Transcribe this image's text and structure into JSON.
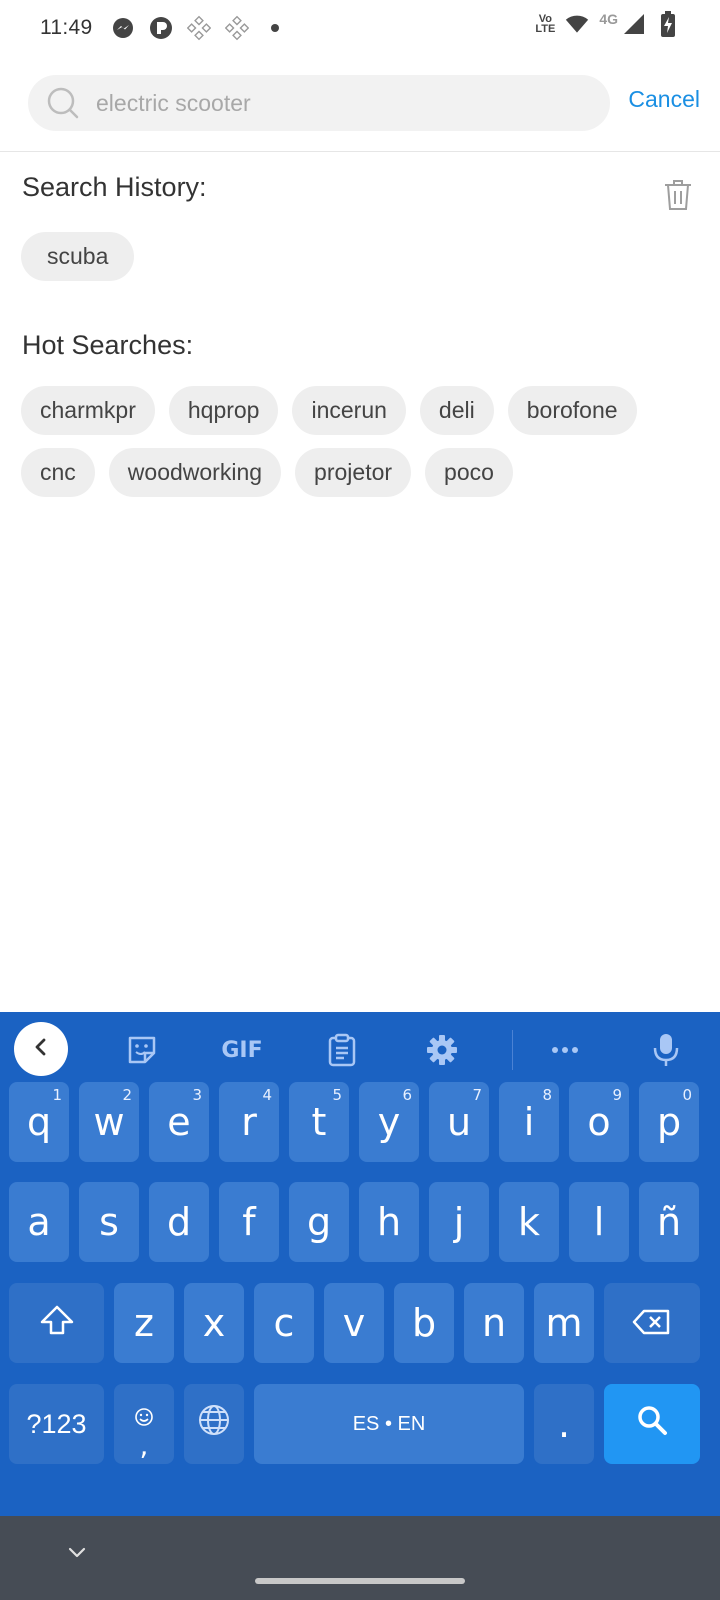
{
  "status_bar": {
    "time": "11:49",
    "volte_top": "Vo",
    "volte_bottom": "LTE",
    "network": "4G"
  },
  "search": {
    "placeholder": "electric scooter",
    "cancel_label": "Cancel"
  },
  "history": {
    "title": "Search History:",
    "items": [
      "scuba"
    ]
  },
  "hot": {
    "title": "Hot Searches:",
    "items": [
      "charmkpr",
      "hqprop",
      "incerun",
      "deli",
      "borofone",
      "cnc",
      "woodworking",
      "projetor",
      "poco"
    ]
  },
  "keyboard": {
    "toolbar": {
      "gif_label": "GIF"
    },
    "row1": [
      {
        "letter": "q",
        "hint": "1"
      },
      {
        "letter": "w",
        "hint": "2"
      },
      {
        "letter": "e",
        "hint": "3"
      },
      {
        "letter": "r",
        "hint": "4"
      },
      {
        "letter": "t",
        "hint": "5"
      },
      {
        "letter": "y",
        "hint": "6"
      },
      {
        "letter": "u",
        "hint": "7"
      },
      {
        "letter": "i",
        "hint": "8"
      },
      {
        "letter": "o",
        "hint": "9"
      },
      {
        "letter": "p",
        "hint": "0"
      }
    ],
    "row2": [
      "a",
      "s",
      "d",
      "f",
      "g",
      "h",
      "j",
      "k",
      "l",
      "ñ"
    ],
    "row3": [
      "z",
      "x",
      "c",
      "v",
      "b",
      "n",
      "m"
    ],
    "symbols_label": "?123",
    "comma_label": ",",
    "space_label": "ES • EN",
    "period_label": "."
  },
  "colors": {
    "accent": "#1a8fe3",
    "keyboard_bg": "#1b62c2",
    "key_bg": "#3a7cd1",
    "search_key": "#2196f3",
    "nav_bar": "#464c55"
  }
}
